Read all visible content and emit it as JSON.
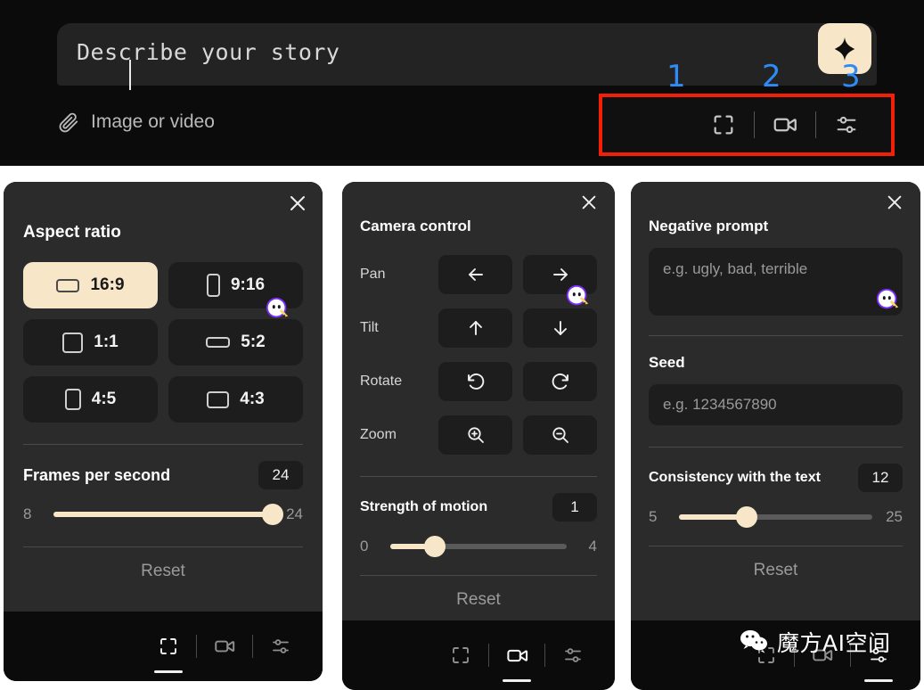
{
  "composer": {
    "prompt_placeholder": "Describe your story",
    "attach_label": "Image or video",
    "attach_icon": "paperclip-icon",
    "generate_icon": "sparkle-icon",
    "toolbar": {
      "items": [
        {
          "icon": "aspect-ratio-icon",
          "callout": "1"
        },
        {
          "icon": "video-camera-icon",
          "callout": "2"
        },
        {
          "icon": "sliders-settings-icon",
          "callout": "3"
        }
      ],
      "highlight_color": "#f41f07",
      "callout_color": "#2e8bf7"
    }
  },
  "panels": [
    {
      "id": "aspect",
      "title": "Aspect ratio",
      "close_icon": "close-icon",
      "ratios": [
        {
          "label": "16:9",
          "shape": "landscape-wide",
          "selected": true
        },
        {
          "label": "9:16",
          "shape": "portrait-tall",
          "selected": false
        },
        {
          "label": "1:1",
          "shape": "square",
          "selected": false
        },
        {
          "label": "5:2",
          "shape": "landscape-ultra",
          "selected": false
        },
        {
          "label": "4:5",
          "shape": "portrait",
          "selected": false
        },
        {
          "label": "4:3",
          "shape": "landscape",
          "selected": false
        }
      ],
      "slider": {
        "label": "Frames per second",
        "value": "24",
        "min": "8",
        "max": "24",
        "percent": 100
      },
      "reset_label": "Reset",
      "nav_active_index": 0
    },
    {
      "id": "camera",
      "title": "Camera control",
      "close_icon": "close-icon",
      "controls": [
        {
          "label": "Pan",
          "buttons": [
            "arrow-left-icon",
            "arrow-right-icon"
          ]
        },
        {
          "label": "Tilt",
          "buttons": [
            "arrow-up-icon",
            "arrow-down-icon"
          ]
        },
        {
          "label": "Rotate",
          "buttons": [
            "rotate-ccw-icon",
            "rotate-cw-icon"
          ]
        },
        {
          "label": "Zoom",
          "buttons": [
            "zoom-in-icon",
            "zoom-out-icon"
          ]
        }
      ],
      "slider": {
        "label": "Strength of motion",
        "value": "1",
        "min": "0",
        "max": "4",
        "percent": 25
      },
      "reset_label": "Reset",
      "nav_active_index": 1
    },
    {
      "id": "advanced",
      "title": "Negative prompt",
      "close_icon": "close-icon",
      "negative_placeholder": "e.g. ugly, bad, terrible",
      "seed_title": "Seed",
      "seed_placeholder": "e.g. 1234567890",
      "slider": {
        "label": "Consistency with the text",
        "value": "12",
        "min": "5",
        "max": "25",
        "percent": 35
      },
      "reset_label": "Reset",
      "nav_active_index": 2
    }
  ],
  "nav": {
    "items": [
      {
        "icon": "aspect-ratio-icon"
      },
      {
        "icon": "video-camera-icon"
      },
      {
        "icon": "sliders-settings-icon"
      }
    ]
  },
  "watermark": {
    "icon": "wechat-icon",
    "text": "魔方AI空间"
  },
  "theme": {
    "accent": "#f7e7c8",
    "panel_bg": "#2b2b2b",
    "app_bg": "#0b0b0b",
    "control_bg": "#1d1d1d"
  }
}
